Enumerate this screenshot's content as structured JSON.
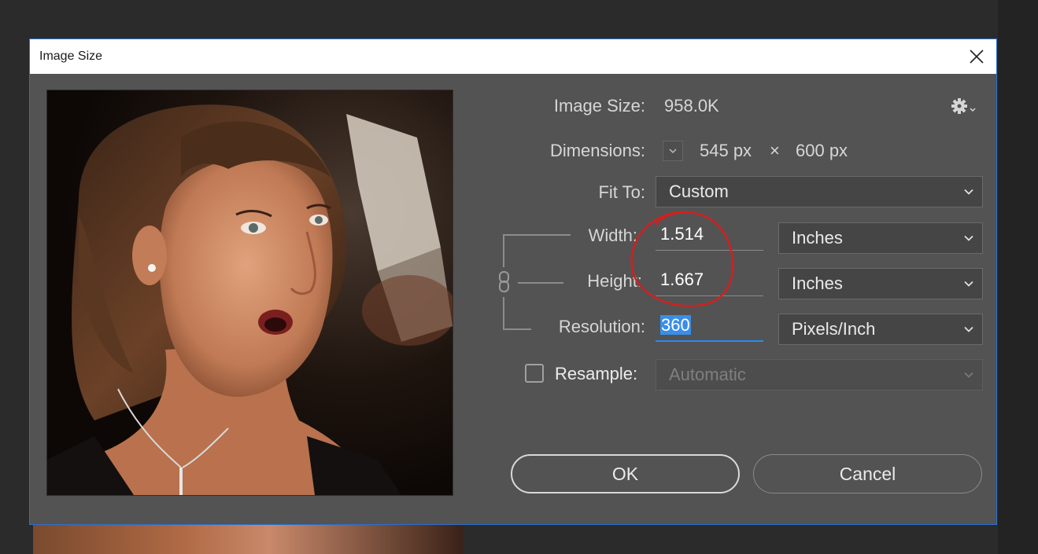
{
  "dialog": {
    "title": "Image Size"
  },
  "info": {
    "image_size_label": "Image Size:",
    "image_size_value": "958.0K",
    "dimensions_label": "Dimensions:",
    "width_px": "545 px",
    "times": "×",
    "height_px": "600 px"
  },
  "fit_to": {
    "label": "Fit To:",
    "value": "Custom"
  },
  "width": {
    "label": "Width:",
    "value": "1.514",
    "unit": "Inches"
  },
  "height": {
    "label": "Height:",
    "value": "1.667",
    "unit": "Inches"
  },
  "resolution": {
    "label": "Resolution:",
    "value": "360",
    "unit": "Pixels/Inch"
  },
  "resample": {
    "label": "Resample:",
    "value": "Automatic",
    "checked": false
  },
  "buttons": {
    "ok": "OK",
    "cancel": "Cancel"
  },
  "icons": {
    "settings": "gear-icon",
    "close": "close-icon",
    "link": "chain-link-icon"
  },
  "colors": {
    "dialog_bg": "#535353",
    "accent_border": "#2a6fcf",
    "selection": "#3a8ee8",
    "annotation": "#d41f1f"
  }
}
